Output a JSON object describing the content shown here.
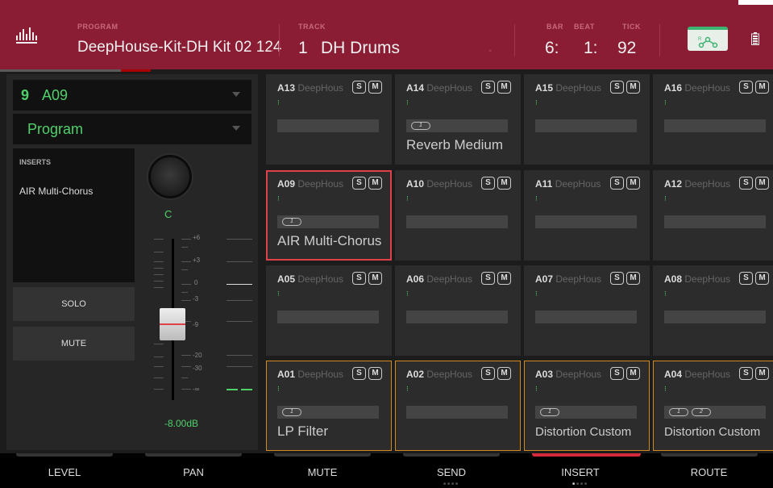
{
  "header": {
    "program_label": "PROGRAM",
    "program_value": "DeepHouse-Kit-DH Kit 02 124",
    "track_label": "TRACK",
    "track_number": "1",
    "track_name": "DH Drums",
    "bar_label": "BAR",
    "beat_label": "BEAT",
    "tick_label": "TICK",
    "bar_value": "6:",
    "beat_value": "1:",
    "tick_value": "92",
    "route_icon": "routing-icon",
    "battery_icon": "battery-icon",
    "logo_icon": "waveform-logo-icon"
  },
  "left": {
    "pad_number": "9",
    "pad_name": "A09",
    "program_mode": "Program",
    "inserts_label": "INSERTS",
    "insert_item": "AIR Multi-Chorus",
    "pan_value": "C",
    "solo_label": "SOLO",
    "mute_label": "MUTE",
    "fader_scale": [
      "+6",
      "+3",
      "0",
      "-3",
      "-9",
      "-20",
      "-30",
      "-∞"
    ],
    "fader_value": "-8.00dB",
    "fader_level_db": -8
  },
  "pads": [
    {
      "id": "A13",
      "name": "DeepHous",
      "fx": "",
      "chips": []
    },
    {
      "id": "A14",
      "name": "DeepHous",
      "fx": "Reverb Medium",
      "chips": [
        "1"
      ]
    },
    {
      "id": "A15",
      "name": "DeepHous",
      "fx": "",
      "chips": []
    },
    {
      "id": "A16",
      "name": "DeepHous",
      "fx": "",
      "chips": []
    },
    {
      "id": "A09",
      "name": "DeepHous",
      "fx": "AIR Multi-Chorus",
      "chips": [
        "1"
      ]
    },
    {
      "id": "A10",
      "name": "DeepHous",
      "fx": "",
      "chips": []
    },
    {
      "id": "A11",
      "name": "DeepHous",
      "fx": "",
      "chips": []
    },
    {
      "id": "A12",
      "name": "DeepHous",
      "fx": "",
      "chips": []
    },
    {
      "id": "A05",
      "name": "DeepHous",
      "fx": "",
      "chips": []
    },
    {
      "id": "A06",
      "name": "DeepHous",
      "fx": "",
      "chips": []
    },
    {
      "id": "A07",
      "name": "DeepHous",
      "fx": "",
      "chips": []
    },
    {
      "id": "A08",
      "name": "DeepHous",
      "fx": "",
      "chips": []
    },
    {
      "id": "A01",
      "name": "DeepHous",
      "fx": "LP Filter",
      "chips": [
        "1"
      ]
    },
    {
      "id": "A02",
      "name": "DeepHous",
      "fx": "",
      "chips": []
    },
    {
      "id": "A03",
      "name": "DeepHous",
      "fx": "Distortion Custom",
      "chips": [
        "1"
      ]
    },
    {
      "id": "A04",
      "name": "DeepHous",
      "fx": "Distortion Custom",
      "chips": [
        "1",
        "2"
      ]
    }
  ],
  "pad_solo_label": "S",
  "pad_mute_label": "M",
  "tabs": [
    {
      "label": "LEVEL"
    },
    {
      "label": "PAN"
    },
    {
      "label": "MUTE"
    },
    {
      "label": "SEND"
    },
    {
      "label": "INSERT"
    },
    {
      "label": "ROUTE"
    }
  ],
  "active_tab": "INSERT",
  "colors": {
    "header_bg": "#8a1c33",
    "accent_green": "#4fd16a",
    "selected_red": "#e0404a",
    "selected_orange": "#d08a20"
  }
}
